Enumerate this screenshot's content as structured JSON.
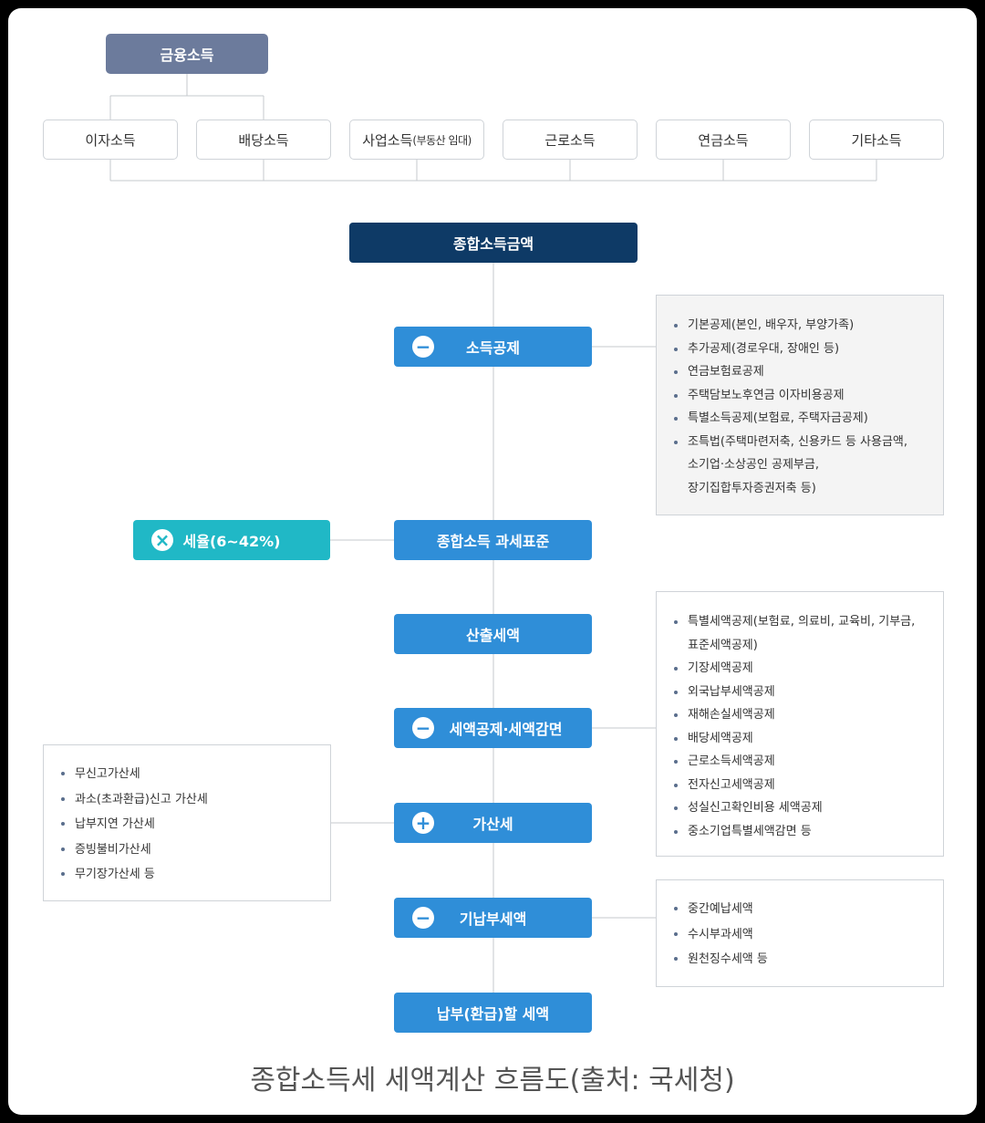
{
  "top_box": "금융소득",
  "income_sources": [
    "이자소득",
    "배당소득",
    "사업소득",
    "근로소득",
    "연금소득",
    "기타소득"
  ],
  "business_note": "(부동산 임대)",
  "flow": {
    "total_income": "종합소득금액",
    "income_deduction": "소득공제",
    "tax_base": "종합소득 과세표준",
    "calculated_tax": "산출세액",
    "tax_credit": "세액공제·세액감면",
    "penalty": "가산세",
    "prepaid": "기납부세액",
    "payable": "납부(환급)할 세액"
  },
  "tax_rate": "세율(6~42%)",
  "operators": {
    "minus": "−",
    "plus": "+",
    "times": "×"
  },
  "deduction_list": [
    "기본공제(본인, 배우자, 부양가족)",
    "추가공제(경로우대, 장애인 등)",
    "연금보험료공제",
    "주택담보노후연금 이자비용공제",
    "특별소득공제(보험료, 주택자금공제)",
    "조특법(주택마련저축, 신용카드 등 사용금액,",
    "소기업·소상공인 공제부금,",
    "장기집합투자증권저축 등)"
  ],
  "credit_list": [
    "특별세액공제(보험료, 의료비, 교육비, 기부금,",
    "표준세액공제)",
    "기장세액공제",
    "외국납부세액공제",
    "재해손실세액공제",
    "배당세액공제",
    "근로소득세액공제",
    "전자신고세액공제",
    "성실신고확인비용 세액공제",
    "중소기업특별세액감면 등"
  ],
  "penalty_list": [
    "무신고가산세",
    "과소(초과환급)신고 가산세",
    "납부지연 가산세",
    "증빙불비가산세",
    "무기장가산세 등"
  ],
  "prepaid_list": [
    "중간예납세액",
    "수시부과세액",
    "원천징수세액 등"
  ],
  "caption": "종합소득세 세액계산 흐름도(출처: 국세청)"
}
